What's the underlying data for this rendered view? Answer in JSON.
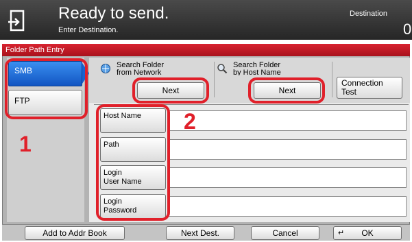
{
  "header": {
    "title": "Ready to send.",
    "subtitle": "Enter Destination.",
    "destination_label": "Destination",
    "destination_count": "0"
  },
  "screen": {
    "tab_title": "Folder Path Entry",
    "protocols": [
      {
        "label": "SMB",
        "selected": true
      },
      {
        "label": "FTP",
        "selected": false
      }
    ],
    "search_network": {
      "line1": "Search Folder",
      "line2": "from Network",
      "button": "Next"
    },
    "search_host": {
      "line1": "Search Folder",
      "line2": "by Host Name",
      "button": "Next"
    },
    "connection_test": {
      "line1": "Connection",
      "line2": "Test"
    },
    "fields": [
      {
        "line1": "Host Name",
        "line2": "",
        "value": ""
      },
      {
        "line1": "Path",
        "line2": "",
        "value": ""
      },
      {
        "line1": "Login",
        "line2": "User Name",
        "value": ""
      },
      {
        "line1": "Login",
        "line2": "Password",
        "value": ""
      }
    ]
  },
  "bottom": {
    "add_to_addr_book": "Add to Addr Book",
    "next_dest": "Next Dest.",
    "cancel": "Cancel",
    "ok": "OK"
  },
  "annotations": {
    "step1": "1",
    "step2": "2"
  },
  "colors": {
    "header": "#333333",
    "tab_red": "#c41a26",
    "selected_blue": "#1e6fdc",
    "annotation_red": "#e0202a"
  },
  "icons": [
    "send-icon",
    "search-network-icon",
    "magnifier-icon",
    "enter-icon"
  ]
}
